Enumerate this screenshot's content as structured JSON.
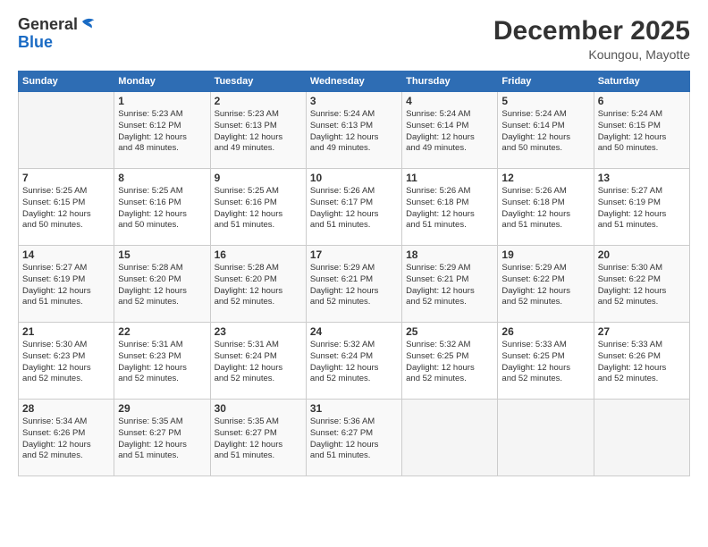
{
  "header": {
    "logo_general": "General",
    "logo_blue": "Blue",
    "title": "December 2025",
    "subtitle": "Koungou, Mayotte"
  },
  "calendar": {
    "days_of_week": [
      "Sunday",
      "Monday",
      "Tuesday",
      "Wednesday",
      "Thursday",
      "Friday",
      "Saturday"
    ],
    "weeks": [
      [
        {
          "day": "",
          "detail": ""
        },
        {
          "day": "1",
          "detail": "Sunrise: 5:23 AM\nSunset: 6:12 PM\nDaylight: 12 hours\nand 48 minutes."
        },
        {
          "day": "2",
          "detail": "Sunrise: 5:23 AM\nSunset: 6:13 PM\nDaylight: 12 hours\nand 49 minutes."
        },
        {
          "day": "3",
          "detail": "Sunrise: 5:24 AM\nSunset: 6:13 PM\nDaylight: 12 hours\nand 49 minutes."
        },
        {
          "day": "4",
          "detail": "Sunrise: 5:24 AM\nSunset: 6:14 PM\nDaylight: 12 hours\nand 49 minutes."
        },
        {
          "day": "5",
          "detail": "Sunrise: 5:24 AM\nSunset: 6:14 PM\nDaylight: 12 hours\nand 50 minutes."
        },
        {
          "day": "6",
          "detail": "Sunrise: 5:24 AM\nSunset: 6:15 PM\nDaylight: 12 hours\nand 50 minutes."
        }
      ],
      [
        {
          "day": "7",
          "detail": "Sunrise: 5:25 AM\nSunset: 6:15 PM\nDaylight: 12 hours\nand 50 minutes."
        },
        {
          "day": "8",
          "detail": "Sunrise: 5:25 AM\nSunset: 6:16 PM\nDaylight: 12 hours\nand 50 minutes."
        },
        {
          "day": "9",
          "detail": "Sunrise: 5:25 AM\nSunset: 6:16 PM\nDaylight: 12 hours\nand 51 minutes."
        },
        {
          "day": "10",
          "detail": "Sunrise: 5:26 AM\nSunset: 6:17 PM\nDaylight: 12 hours\nand 51 minutes."
        },
        {
          "day": "11",
          "detail": "Sunrise: 5:26 AM\nSunset: 6:18 PM\nDaylight: 12 hours\nand 51 minutes."
        },
        {
          "day": "12",
          "detail": "Sunrise: 5:26 AM\nSunset: 6:18 PM\nDaylight: 12 hours\nand 51 minutes."
        },
        {
          "day": "13",
          "detail": "Sunrise: 5:27 AM\nSunset: 6:19 PM\nDaylight: 12 hours\nand 51 minutes."
        }
      ],
      [
        {
          "day": "14",
          "detail": "Sunrise: 5:27 AM\nSunset: 6:19 PM\nDaylight: 12 hours\nand 51 minutes."
        },
        {
          "day": "15",
          "detail": "Sunrise: 5:28 AM\nSunset: 6:20 PM\nDaylight: 12 hours\nand 52 minutes."
        },
        {
          "day": "16",
          "detail": "Sunrise: 5:28 AM\nSunset: 6:20 PM\nDaylight: 12 hours\nand 52 minutes."
        },
        {
          "day": "17",
          "detail": "Sunrise: 5:29 AM\nSunset: 6:21 PM\nDaylight: 12 hours\nand 52 minutes."
        },
        {
          "day": "18",
          "detail": "Sunrise: 5:29 AM\nSunset: 6:21 PM\nDaylight: 12 hours\nand 52 minutes."
        },
        {
          "day": "19",
          "detail": "Sunrise: 5:29 AM\nSunset: 6:22 PM\nDaylight: 12 hours\nand 52 minutes."
        },
        {
          "day": "20",
          "detail": "Sunrise: 5:30 AM\nSunset: 6:22 PM\nDaylight: 12 hours\nand 52 minutes."
        }
      ],
      [
        {
          "day": "21",
          "detail": "Sunrise: 5:30 AM\nSunset: 6:23 PM\nDaylight: 12 hours\nand 52 minutes."
        },
        {
          "day": "22",
          "detail": "Sunrise: 5:31 AM\nSunset: 6:23 PM\nDaylight: 12 hours\nand 52 minutes."
        },
        {
          "day": "23",
          "detail": "Sunrise: 5:31 AM\nSunset: 6:24 PM\nDaylight: 12 hours\nand 52 minutes."
        },
        {
          "day": "24",
          "detail": "Sunrise: 5:32 AM\nSunset: 6:24 PM\nDaylight: 12 hours\nand 52 minutes."
        },
        {
          "day": "25",
          "detail": "Sunrise: 5:32 AM\nSunset: 6:25 PM\nDaylight: 12 hours\nand 52 minutes."
        },
        {
          "day": "26",
          "detail": "Sunrise: 5:33 AM\nSunset: 6:25 PM\nDaylight: 12 hours\nand 52 minutes."
        },
        {
          "day": "27",
          "detail": "Sunrise: 5:33 AM\nSunset: 6:26 PM\nDaylight: 12 hours\nand 52 minutes."
        }
      ],
      [
        {
          "day": "28",
          "detail": "Sunrise: 5:34 AM\nSunset: 6:26 PM\nDaylight: 12 hours\nand 52 minutes."
        },
        {
          "day": "29",
          "detail": "Sunrise: 5:35 AM\nSunset: 6:27 PM\nDaylight: 12 hours\nand 51 minutes."
        },
        {
          "day": "30",
          "detail": "Sunrise: 5:35 AM\nSunset: 6:27 PM\nDaylight: 12 hours\nand 51 minutes."
        },
        {
          "day": "31",
          "detail": "Sunrise: 5:36 AM\nSunset: 6:27 PM\nDaylight: 12 hours\nand 51 minutes."
        },
        {
          "day": "",
          "detail": ""
        },
        {
          "day": "",
          "detail": ""
        },
        {
          "day": "",
          "detail": ""
        }
      ]
    ]
  }
}
